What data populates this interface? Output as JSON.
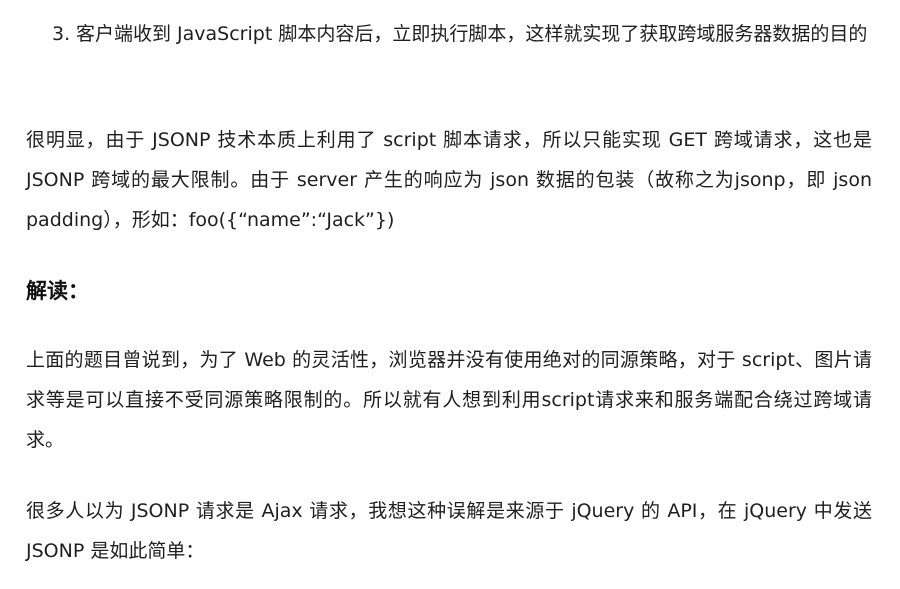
{
  "list": {
    "item3": {
      "number": "3.",
      "text": "客户端收到 JavaScript 脚本内容后，立即执行脚本，这样就实现了获取跨域服务器数据的目的"
    }
  },
  "paragraphs": {
    "p1": "很明显，由于 JSONP 技术本质上利用了 script 脚本请求，所以只能实现 GET 跨域请求，这也是 JSONP 跨域的最大限制。由于 server 产生的响应为 json 数据的包装（故称之为jsonp，即 json padding），形如：foo({“name”:“Jack”})",
    "p2": "上面的题目曾说到，为了 Web 的灵活性，浏览器并没有使用绝对的同源策略，对于 script、图片请求等是可以直接不受同源策略限制的。所以就有人想到利用script请求来和服务端配合绕过跨域请求。",
    "p3": "很多人以为 JSONP 请求是 Ajax 请求，我想这种误解是来源于 jQuery 的 API，在 jQuery 中发送 JSONP 是如此简单："
  },
  "section": {
    "heading": "解读："
  }
}
